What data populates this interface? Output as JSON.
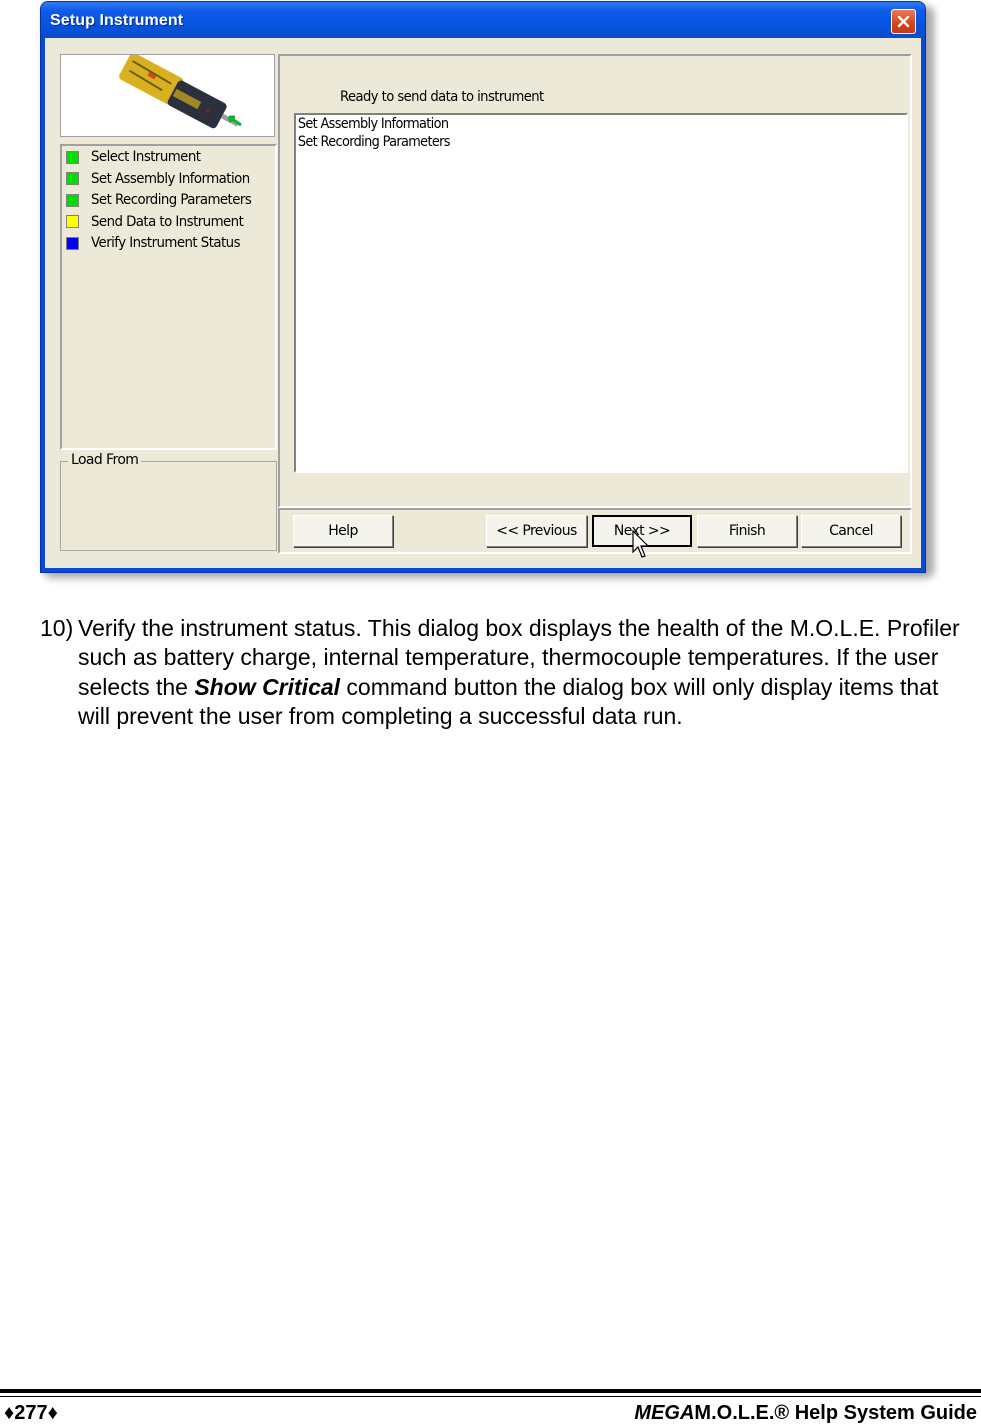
{
  "dialog": {
    "title": "Setup Instrument",
    "close_icon": "close-icon",
    "instrument_image": "mole-profiler-device-image",
    "steps": [
      {
        "label": "Select Instrument",
        "status_color": "#00e000"
      },
      {
        "label": "Set Assembly Information",
        "status_color": "#00e000"
      },
      {
        "label": "Set Recording Parameters",
        "status_color": "#00e000"
      },
      {
        "label": "Send Data to Instrument",
        "status_color": "#ffff00"
      },
      {
        "label": "Verify Instrument Status",
        "status_color": "#0000ff"
      }
    ],
    "load_from_label": "Load From",
    "status_message": "Ready to send data to instrument",
    "list_items": [
      "Set Assembly Information",
      "Set Recording Parameters"
    ],
    "buttons": {
      "help": "Help",
      "previous": "<< Previous",
      "next": "Next >>",
      "finish": "Finish",
      "cancel": "Cancel"
    },
    "cursor_icon": "mouse-pointer-icon"
  },
  "document": {
    "step_number": "10)",
    "text_before": "Verify the instrument status. This dialog box displays the health of the M.O.L.E. Profiler such as battery charge, internal temperature, thermocouple temperatures. If the user selects the ",
    "emphasis": "Show Critical",
    "text_after": " command button the dialog box will only display items that will prevent the user from completing a successful data run."
  },
  "footer": {
    "page_number": "♦277♦",
    "guide_title_italic": "MEGA",
    "guide_title_rest": "M.O.L.E.® Help System Guide"
  }
}
